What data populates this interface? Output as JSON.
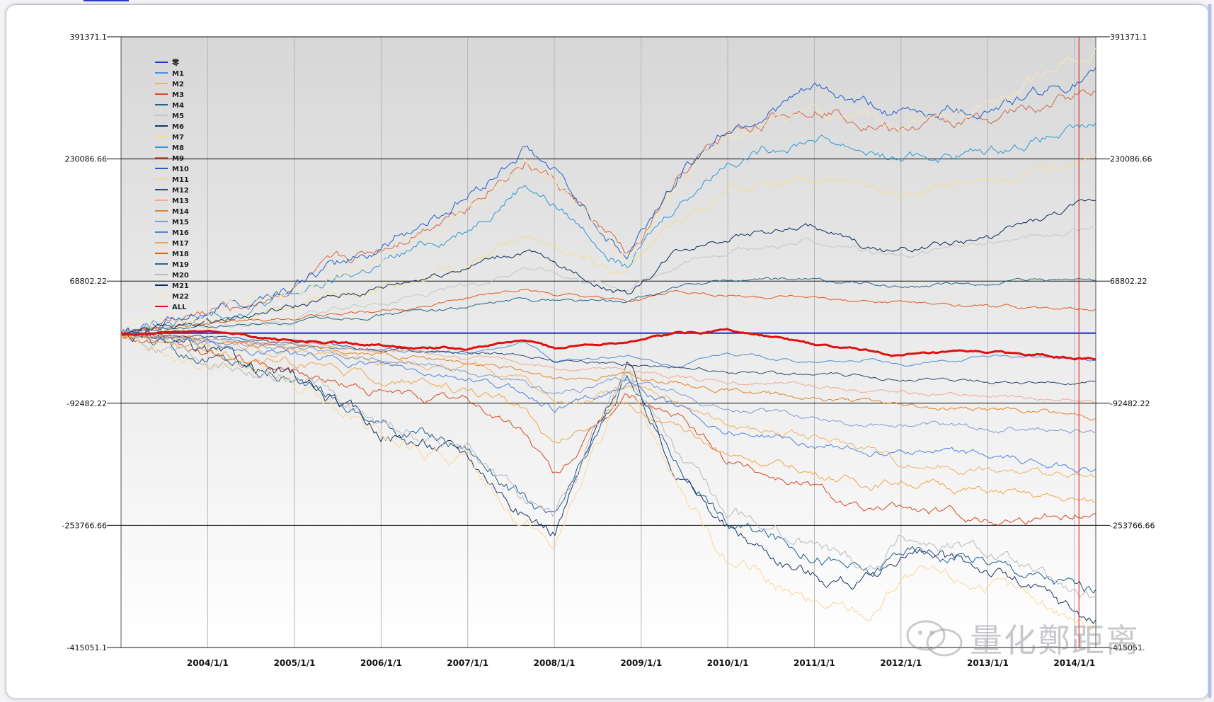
{
  "watermark": {
    "text": "量化鄭距离"
  },
  "chart_data": {
    "type": "line",
    "title": "",
    "xlabel": "",
    "ylabel": "",
    "ylim": [
      -415051.1,
      391371.1
    ],
    "xlim": [
      "2003-01-01",
      "2014-04-01"
    ],
    "yticks": [
      391371.1,
      230086.66,
      68802.22,
      -92482.22,
      -253766.66,
      -415051.1
    ],
    "ytick_labels_left": [
      "391371.1",
      "230086.66",
      "68802.22",
      "-92482.22",
      "-253766.66",
      "-415051.1"
    ],
    "ytick_labels_right": [
      "391371.1",
      "230086.66",
      "68802.22",
      "-92482.22",
      "-253766.66",
      "-415051."
    ],
    "xticks": [
      "2004-01-01",
      "2005-01-01",
      "2006-01-01",
      "2007-01-01",
      "2008-01-01",
      "2009-01-01",
      "2010-01-01",
      "2011-01-01",
      "2012-01-01",
      "2013-01-01",
      "2014-01-01"
    ],
    "xtick_labels": [
      "2004/1/1",
      "2005/1/1",
      "2006/1/1",
      "2007/1/1",
      "2008/1/1",
      "2009/1/1",
      "2010/1/1",
      "2011/1/1",
      "2012/1/1",
      "2013/1/1",
      "2014/1/1"
    ],
    "marker_line_date": "2014-01-20",
    "grid": true,
    "legend_position": "top-left",
    "x": [
      "2003-01-01",
      "2004-01-01",
      "2005-01-01",
      "2006-01-01",
      "2007-01-01",
      "2007-09-01",
      "2008-01-01",
      "2008-11-01",
      "2009-06-01",
      "2010-01-01",
      "2011-01-01",
      "2011-09-01",
      "2012-01-01",
      "2013-01-01",
      "2014-04-01"
    ],
    "series": [
      {
        "name": "零",
        "color": "#1c2fd0",
        "width": 2,
        "values": [
          0,
          0,
          0,
          0,
          0,
          0,
          0,
          0,
          0,
          0,
          0,
          0,
          0,
          0,
          0
        ]
      },
      {
        "name": "M1",
        "color": "#4a8fd6",
        "width": 1,
        "values": [
          0,
          -8000,
          -15000,
          -22000,
          -28000,
          -10000,
          -38000,
          -30000,
          -45000,
          -25000,
          -40000,
          -35000,
          -45000,
          -30000,
          -35000
        ]
      },
      {
        "name": "M2",
        "color": "#f2b35e",
        "width": 1,
        "values": [
          0,
          -15000,
          -22000,
          -35000,
          -45000,
          -60000,
          -100000,
          -70000,
          -90000,
          -120000,
          -140000,
          -150000,
          -170000,
          -180000,
          -195000
        ]
      },
      {
        "name": "M3",
        "color": "#d64a1e",
        "width": 1,
        "values": [
          0,
          -30000,
          -50000,
          -80000,
          -90000,
          -130000,
          -190000,
          -80000,
          -110000,
          -170000,
          -200000,
          -240000,
          -230000,
          -245000,
          -235000
        ]
      },
      {
        "name": "M4",
        "color": "#1e5f8e",
        "width": 1,
        "values": [
          0,
          -30000,
          -60000,
          -120000,
          -150000,
          -220000,
          -250000,
          -60000,
          -170000,
          -250000,
          -290000,
          -320000,
          -285000,
          -300000,
          -340000
        ]
      },
      {
        "name": "M5",
        "color": "#c6c6c6",
        "width": 1,
        "values": [
          0,
          10000,
          20000,
          40000,
          60000,
          90000,
          80000,
          60000,
          90000,
          110000,
          120000,
          110000,
          100000,
          120000,
          140000
        ]
      },
      {
        "name": "M6",
        "color": "#1b3464",
        "width": 1,
        "values": [
          0,
          -30000,
          -60000,
          -130000,
          -160000,
          -240000,
          -260000,
          -40000,
          -180000,
          -260000,
          -320000,
          -330000,
          -290000,
          -310000,
          -380000
        ]
      },
      {
        "name": "M7",
        "color": "#f6dc8a",
        "width": 1,
        "values": [
          0,
          15000,
          35000,
          60000,
          90000,
          130000,
          120000,
          80000,
          150000,
          190000,
          200000,
          200000,
          190000,
          200000,
          230000
        ]
      },
      {
        "name": "M8",
        "color": "#2b9ad6",
        "width": 1,
        "values": [
          0,
          20000,
          50000,
          90000,
          140000,
          200000,
          170000,
          90000,
          170000,
          230000,
          260000,
          240000,
          230000,
          240000,
          270000
        ]
      },
      {
        "name": "M9",
        "color": "#d0694a",
        "width": 1,
        "values": [
          0,
          25000,
          60000,
          110000,
          170000,
          230000,
          200000,
          100000,
          200000,
          260000,
          300000,
          280000,
          270000,
          280000,
          320000
        ]
      },
      {
        "name": "M10",
        "color": "#1f5fcc",
        "width": 1,
        "values": [
          0,
          30000,
          65000,
          115000,
          180000,
          245000,
          210000,
          100000,
          210000,
          270000,
          320000,
          300000,
          290000,
          300000,
          340000
        ]
      },
      {
        "name": "M11",
        "color": "#f9d79a",
        "width": 1,
        "values": [
          0,
          -35000,
          -70000,
          -140000,
          -170000,
          -250000,
          -280000,
          -60000,
          -200000,
          -300000,
          -360000,
          -370000,
          -320000,
          -330000,
          -385000
        ]
      },
      {
        "name": "M12",
        "color": "#2d4773",
        "width": 1,
        "values": [
          0,
          -6000,
          -12000,
          -20000,
          -26000,
          -30000,
          -35000,
          -40000,
          -45000,
          -50000,
          -55000,
          -58000,
          -60000,
          -64000,
          -68000
        ]
      },
      {
        "name": "M13",
        "color": "#f5a88c",
        "width": 1,
        "values": [
          0,
          -8000,
          -15000,
          -25000,
          -32000,
          -40000,
          -45000,
          -50000,
          -58000,
          -65000,
          -70000,
          -75000,
          -80000,
          -84000,
          -90000
        ]
      },
      {
        "name": "M14",
        "color": "#e48324",
        "width": 1,
        "values": [
          0,
          -10000,
          -18000,
          -30000,
          -40000,
          -50000,
          -60000,
          -55000,
          -65000,
          -75000,
          -85000,
          -90000,
          -95000,
          -100000,
          -110000
        ]
      },
      {
        "name": "M15",
        "color": "#7f9bd0",
        "width": 1,
        "values": [
          0,
          -10000,
          -20000,
          -35000,
          -50000,
          -70000,
          -80000,
          -60000,
          -80000,
          -100000,
          -110000,
          -120000,
          -120000,
          -125000,
          -130000
        ]
      },
      {
        "name": "M16",
        "color": "#4f83d8",
        "width": 1,
        "values": [
          0,
          -15000,
          -28000,
          -45000,
          -60000,
          -80000,
          -100000,
          -70000,
          -100000,
          -130000,
          -145000,
          -160000,
          -150000,
          -165000,
          -180000
        ]
      },
      {
        "name": "M17",
        "color": "#f0a64a",
        "width": 1,
        "values": [
          0,
          -20000,
          -40000,
          -60000,
          -75000,
          -100000,
          -150000,
          -90000,
          -130000,
          -160000,
          -185000,
          -200000,
          -195000,
          -210000,
          -225000
        ]
      },
      {
        "name": "M18",
        "color": "#e05a1a",
        "width": 1,
        "values": [
          0,
          12000,
          20000,
          30000,
          45000,
          60000,
          50000,
          40000,
          55000,
          50000,
          45000,
          40000,
          40000,
          35000,
          30000
        ]
      },
      {
        "name": "M19",
        "color": "#1e6a8a",
        "width": 1,
        "values": [
          0,
          8000,
          15000,
          25000,
          35000,
          45000,
          45000,
          40000,
          60000,
          70000,
          70000,
          65000,
          60000,
          65000,
          72000
        ]
      },
      {
        "name": "M20",
        "color": "#b8b8c2",
        "width": 1,
        "values": [
          0,
          -30000,
          -60000,
          -120000,
          -150000,
          -220000,
          -250000,
          -50000,
          -160000,
          -240000,
          -280000,
          -310000,
          -270000,
          -290000,
          -360000
        ]
      },
      {
        "name": "M21",
        "color": "#0d2a58",
        "width": 1,
        "values": [
          0,
          15000,
          35000,
          60000,
          90000,
          110000,
          90000,
          50000,
          110000,
          130000,
          140000,
          110000,
          110000,
          125000,
          175000
        ]
      },
      {
        "name": "M22",
        "color": "#fbe6b4",
        "width": 1,
        "values": [
          0,
          25000,
          55000,
          100000,
          160000,
          220000,
          200000,
          90000,
          190000,
          250000,
          290000,
          280000,
          265000,
          300000,
          370000
        ]
      },
      {
        "name": "ALL",
        "color": "#e01010",
        "width": 3,
        "values": [
          0,
          2000,
          -10000,
          -15000,
          -20000,
          -10000,
          -20000,
          -10000,
          0,
          5000,
          -15000,
          -25000,
          -30000,
          -25000,
          -35000
        ]
      }
    ]
  }
}
